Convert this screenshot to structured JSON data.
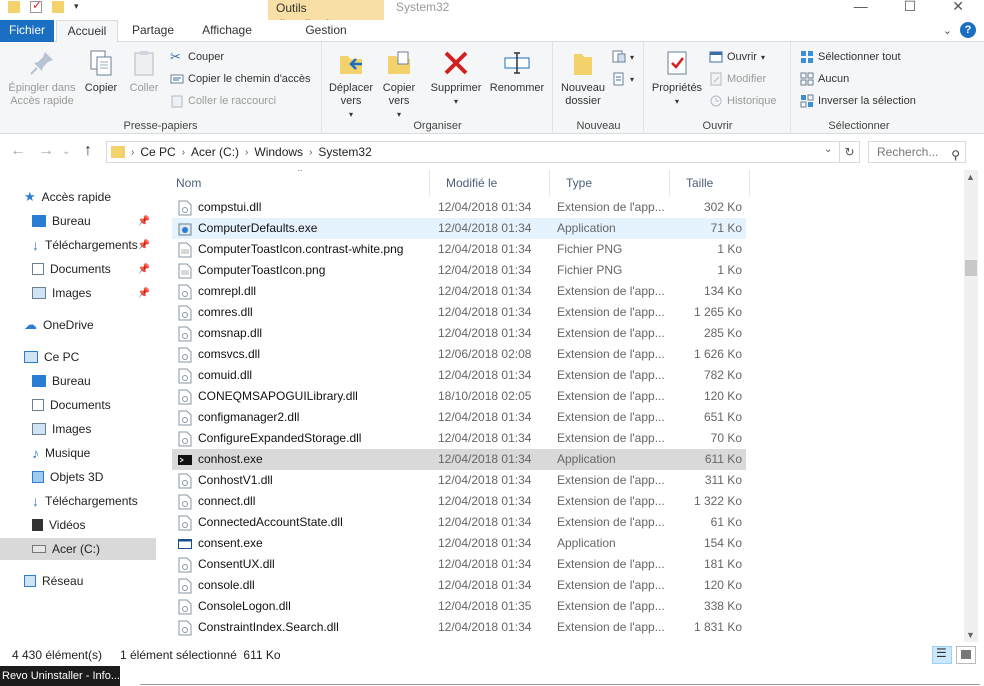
{
  "titlebar": {
    "context_tab": "Outils d'application",
    "window_title": "System32",
    "minimize": "—",
    "maximize": "☐",
    "close": "✕"
  },
  "tabs": {
    "file": "Fichier",
    "home": "Accueil",
    "share": "Partage",
    "view": "Affichage",
    "manage": "Gestion"
  },
  "ribbon": {
    "clipboard": {
      "label": "Presse-papiers",
      "pin": "Épingler dans Accès rapide",
      "copy": "Copier",
      "paste": "Coller",
      "cut": "Couper",
      "copy_path": "Copier le chemin d'accès",
      "paste_shortcut": "Coller le raccourci"
    },
    "organize": {
      "label": "Organiser",
      "move_to": "Déplacer vers",
      "copy_to": "Copier vers",
      "delete": "Supprimer",
      "rename": "Renommer"
    },
    "new": {
      "label": "Nouveau",
      "new_folder": "Nouveau dossier"
    },
    "open": {
      "label": "Ouvrir",
      "properties": "Propriétés",
      "open": "Ouvrir",
      "edit": "Modifier",
      "history": "Historique"
    },
    "select": {
      "label": "Sélectionner",
      "select_all": "Sélectionner tout",
      "select_none": "Aucun",
      "invert": "Inverser la sélection"
    }
  },
  "address": {
    "path": [
      "Ce PC",
      "Acer (C:)",
      "Windows",
      "System32"
    ],
    "search_placeholder": "Recherch..."
  },
  "nav": {
    "quick_access": "Accès rapide",
    "qa_items": [
      "Bureau",
      "Téléchargements",
      "Documents",
      "Images"
    ],
    "onedrive": "OneDrive",
    "this_pc": "Ce PC",
    "pc_items": [
      "Bureau",
      "Documents",
      "Images",
      "Musique",
      "Objets 3D",
      "Téléchargements",
      "Vidéos",
      "Acer (C:)"
    ],
    "network": "Réseau"
  },
  "columns": {
    "name": "Nom",
    "modified": "Modifié le",
    "type": "Type",
    "size": "Taille"
  },
  "files": [
    {
      "name": "compstui.dll",
      "date": "12/04/2018 01:34",
      "type": "Extension de l'app...",
      "size": "302 Ko"
    },
    {
      "name": "ComputerDefaults.exe",
      "date": "12/04/2018 01:34",
      "type": "Application",
      "size": "71 Ko"
    },
    {
      "name": "ComputerToastIcon.contrast-white.png",
      "date": "12/04/2018 01:34",
      "type": "Fichier PNG",
      "size": "1 Ko"
    },
    {
      "name": "ComputerToastIcon.png",
      "date": "12/04/2018 01:34",
      "type": "Fichier PNG",
      "size": "1 Ko"
    },
    {
      "name": "comrepl.dll",
      "date": "12/04/2018 01:34",
      "type": "Extension de l'app...",
      "size": "134 Ko"
    },
    {
      "name": "comres.dll",
      "date": "12/04/2018 01:34",
      "type": "Extension de l'app...",
      "size": "1 265 Ko"
    },
    {
      "name": "comsnap.dll",
      "date": "12/04/2018 01:34",
      "type": "Extension de l'app...",
      "size": "285 Ko"
    },
    {
      "name": "comsvcs.dll",
      "date": "12/06/2018 02:08",
      "type": "Extension de l'app...",
      "size": "1 626 Ko"
    },
    {
      "name": "comuid.dll",
      "date": "12/04/2018 01:34",
      "type": "Extension de l'app...",
      "size": "782 Ko"
    },
    {
      "name": "CONEQMSAPOGUILibrary.dll",
      "date": "18/10/2018 02:05",
      "type": "Extension de l'app...",
      "size": "120 Ko"
    },
    {
      "name": "configmanager2.dll",
      "date": "12/04/2018 01:34",
      "type": "Extension de l'app...",
      "size": "651 Ko"
    },
    {
      "name": "ConfigureExpandedStorage.dll",
      "date": "12/04/2018 01:34",
      "type": "Extension de l'app...",
      "size": "70 Ko"
    },
    {
      "name": "conhost.exe",
      "date": "12/04/2018 01:34",
      "type": "Application",
      "size": "611 Ko"
    },
    {
      "name": "ConhostV1.dll",
      "date": "12/04/2018 01:34",
      "type": "Extension de l'app...",
      "size": "311 Ko"
    },
    {
      "name": "connect.dll",
      "date": "12/04/2018 01:34",
      "type": "Extension de l'app...",
      "size": "1 322 Ko"
    },
    {
      "name": "ConnectedAccountState.dll",
      "date": "12/04/2018 01:34",
      "type": "Extension de l'app...",
      "size": "61 Ko"
    },
    {
      "name": "consent.exe",
      "date": "12/04/2018 01:34",
      "type": "Application",
      "size": "154 Ko"
    },
    {
      "name": "ConsentUX.dll",
      "date": "12/04/2018 01:34",
      "type": "Extension de l'app...",
      "size": "181 Ko"
    },
    {
      "name": "console.dll",
      "date": "12/04/2018 01:34",
      "type": "Extension de l'app...",
      "size": "120 Ko"
    },
    {
      "name": "ConsoleLogon.dll",
      "date": "12/04/2018 01:35",
      "type": "Extension de l'app...",
      "size": "338 Ko"
    },
    {
      "name": "ConstraintIndex.Search.dll",
      "date": "12/04/2018 01:34",
      "type": "Extension de l'app...",
      "size": "1 831 Ko"
    }
  ],
  "hover_file": "ComputerDefaults.exe",
  "selected_file": "conhost.exe",
  "status": {
    "count": "4 430 élément(s)",
    "selection": "1 élément sélectionné  611 Ko"
  },
  "taskbar": {
    "item": "Revo Uninstaller - Info..."
  },
  "colors": {
    "accent": "#1a6fc2",
    "context_tab": "#f7dfa5",
    "hover_row": "#e5f3ff",
    "selected_row": "#d9d9d9",
    "header_text": "#4c607a"
  }
}
